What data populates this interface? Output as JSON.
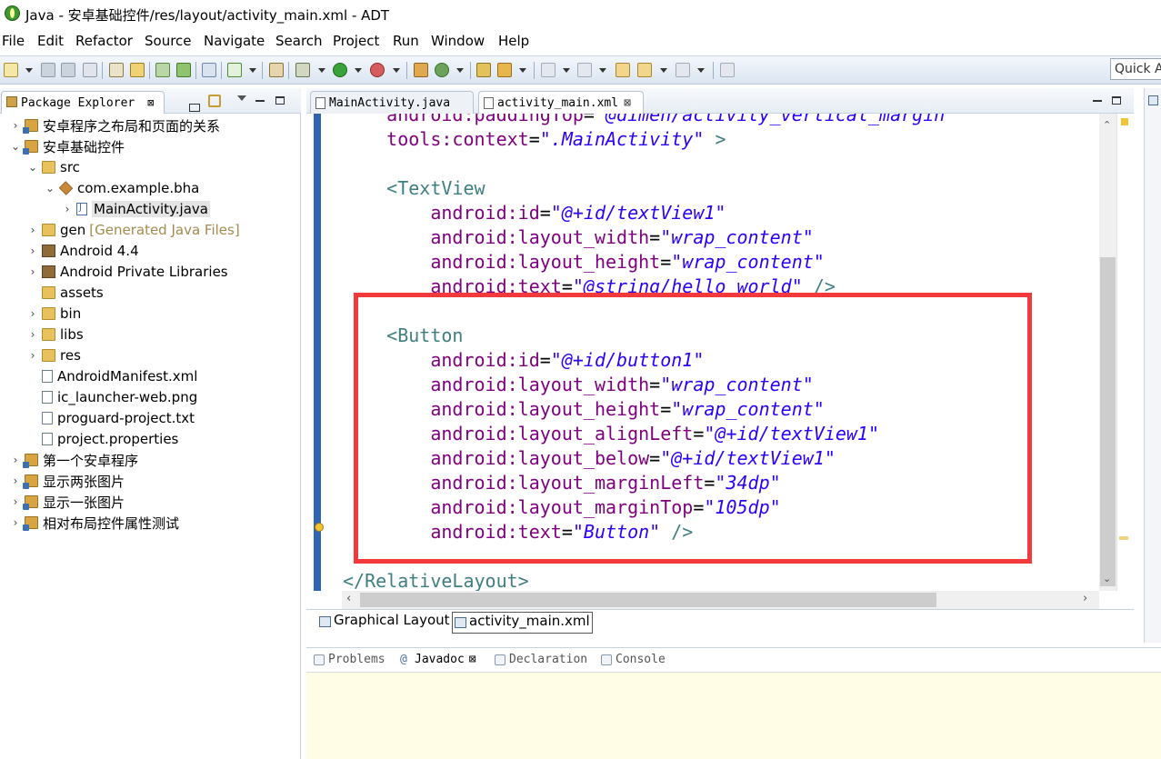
{
  "window": {
    "title": "Java - 安卓基础控件/res/layout/activity_main.xml - ADT"
  },
  "menu": [
    "File",
    "Edit",
    "Refactor",
    "Source",
    "Navigate",
    "Search",
    "Project",
    "Run",
    "Window",
    "Help"
  ],
  "toolbar": {
    "quick_access_placeholder": "Quick Acc"
  },
  "package_explorer": {
    "tab_label": "Package Explorer",
    "close_glyph": "⊠",
    "items": [
      {
        "label": "安卓程序之布局和页面的关系",
        "icon": "project-icon",
        "twisty": "›"
      },
      {
        "label": "安卓基础控件",
        "icon": "project-icon",
        "twisty": "⌄"
      },
      {
        "label": "src",
        "icon": "source-folder-icon",
        "twisty": "⌄"
      },
      {
        "label": "com.example.bha",
        "icon": "package-icon",
        "twisty": "⌄"
      },
      {
        "label": "MainActivity.java",
        "icon": "java-file-icon",
        "twisty": "›"
      },
      {
        "label": "gen",
        "extra": "[Generated Java Files]",
        "icon": "folder-icon",
        "twisty": "›"
      },
      {
        "label": "Android 4.4",
        "icon": "library-icon",
        "twisty": "›"
      },
      {
        "label": "Android Private Libraries",
        "icon": "library-icon",
        "twisty": "›"
      },
      {
        "label": "assets",
        "icon": "folder-icon",
        "twisty": ""
      },
      {
        "label": "bin",
        "icon": "folder-icon",
        "twisty": "›"
      },
      {
        "label": "libs",
        "icon": "folder-icon",
        "twisty": "›"
      },
      {
        "label": "res",
        "icon": "folder-icon",
        "twisty": "›"
      },
      {
        "label": "AndroidManifest.xml",
        "icon": "xml-file-icon",
        "twisty": ""
      },
      {
        "label": "ic_launcher-web.png",
        "icon": "image-file-icon",
        "twisty": ""
      },
      {
        "label": "proguard-project.txt",
        "icon": "text-file-icon",
        "twisty": ""
      },
      {
        "label": "project.properties",
        "icon": "text-file-icon",
        "twisty": ""
      },
      {
        "label": "第一个安卓程序",
        "icon": "project-icon",
        "twisty": "›"
      },
      {
        "label": "显示两张图片",
        "icon": "project-icon",
        "twisty": "›"
      },
      {
        "label": "显示一张图片",
        "icon": "project-icon",
        "twisty": "›"
      },
      {
        "label": "相对布局控件属性测试",
        "icon": "project-icon",
        "twisty": "›"
      }
    ]
  },
  "editor": {
    "tabs": [
      {
        "label": "MainActivity.java",
        "active": false,
        "close": ""
      },
      {
        "label": "activity_main.xml",
        "active": true,
        "close": "⊠"
      }
    ],
    "code_lines": [
      {
        "indent": "    ",
        "parts": [
          [
            "attr",
            "android:paddingTop"
          ],
          [
            "pun",
            "="
          ],
          [
            "val",
            "\"@dimen/activity_vertical_margin\""
          ]
        ]
      },
      {
        "indent": "    ",
        "parts": [
          [
            "attr",
            "tools:context"
          ],
          [
            "pun",
            "="
          ],
          [
            "val",
            "\".MainActivity\""
          ],
          [
            "pun",
            " "
          ],
          [
            "tag",
            ">"
          ]
        ]
      },
      {
        "indent": "",
        "parts": []
      },
      {
        "indent": "    ",
        "parts": [
          [
            "tag",
            "<TextView"
          ]
        ]
      },
      {
        "indent": "        ",
        "parts": [
          [
            "attr",
            "android:id"
          ],
          [
            "pun",
            "="
          ],
          [
            "val",
            "\"@+id/textView1\""
          ]
        ]
      },
      {
        "indent": "        ",
        "parts": [
          [
            "attr",
            "android:layout_width"
          ],
          [
            "pun",
            "="
          ],
          [
            "val",
            "\"wrap_content\""
          ]
        ]
      },
      {
        "indent": "        ",
        "parts": [
          [
            "attr",
            "android:layout_height"
          ],
          [
            "pun",
            "="
          ],
          [
            "val",
            "\"wrap_content\""
          ]
        ]
      },
      {
        "indent": "        ",
        "parts": [
          [
            "attr",
            "android:text"
          ],
          [
            "pun",
            "="
          ],
          [
            "val",
            "\"@string/hello_world\""
          ],
          [
            "pun",
            " "
          ],
          [
            "tag",
            "/>"
          ]
        ]
      },
      {
        "indent": "",
        "parts": []
      },
      {
        "indent": "    ",
        "parts": [
          [
            "tag",
            "<Button"
          ]
        ]
      },
      {
        "indent": "        ",
        "parts": [
          [
            "attr",
            "android:id"
          ],
          [
            "pun",
            "="
          ],
          [
            "val",
            "\"@+id/button1\""
          ]
        ]
      },
      {
        "indent": "        ",
        "parts": [
          [
            "attr",
            "android:layout_width"
          ],
          [
            "pun",
            "="
          ],
          [
            "val",
            "\"wrap_content\""
          ]
        ]
      },
      {
        "indent": "        ",
        "parts": [
          [
            "attr",
            "android:layout_height"
          ],
          [
            "pun",
            "="
          ],
          [
            "val",
            "\"wrap_content\""
          ]
        ]
      },
      {
        "indent": "        ",
        "parts": [
          [
            "attr",
            "android:layout_alignLeft"
          ],
          [
            "pun",
            "="
          ],
          [
            "val",
            "\"@+id/textView1\""
          ]
        ]
      },
      {
        "indent": "        ",
        "parts": [
          [
            "attr",
            "android:layout_below"
          ],
          [
            "pun",
            "="
          ],
          [
            "val",
            "\"@+id/textView1\""
          ]
        ]
      },
      {
        "indent": "        ",
        "parts": [
          [
            "attr",
            "android:layout_marginLeft"
          ],
          [
            "pun",
            "="
          ],
          [
            "val",
            "\"34dp\""
          ]
        ]
      },
      {
        "indent": "        ",
        "parts": [
          [
            "attr",
            "android:layout_marginTop"
          ],
          [
            "pun",
            "="
          ],
          [
            "val",
            "\"105dp\""
          ]
        ]
      },
      {
        "indent": "        ",
        "parts": [
          [
            "attr",
            "android:text"
          ],
          [
            "pun",
            "="
          ],
          [
            "val",
            "\"Button\""
          ],
          [
            "pun",
            " "
          ],
          [
            "tag",
            "/>"
          ]
        ]
      },
      {
        "indent": "",
        "parts": []
      },
      {
        "indent": "",
        "parts": [
          [
            "tag",
            "</RelativeLayout>"
          ]
        ]
      }
    ],
    "bottom_tabs": [
      {
        "label": "Graphical Layout",
        "active": false
      },
      {
        "label": "activity_main.xml",
        "active": true
      }
    ]
  },
  "lower_panel": {
    "tabs": [
      {
        "label": "Problems",
        "active": false,
        "close": ""
      },
      {
        "label": "Javadoc",
        "active": true,
        "close": "⊠"
      },
      {
        "label": "Declaration",
        "active": false,
        "close": ""
      },
      {
        "label": "Console",
        "active": false,
        "close": ""
      }
    ]
  },
  "highlight": {
    "color": "#f2393c"
  }
}
